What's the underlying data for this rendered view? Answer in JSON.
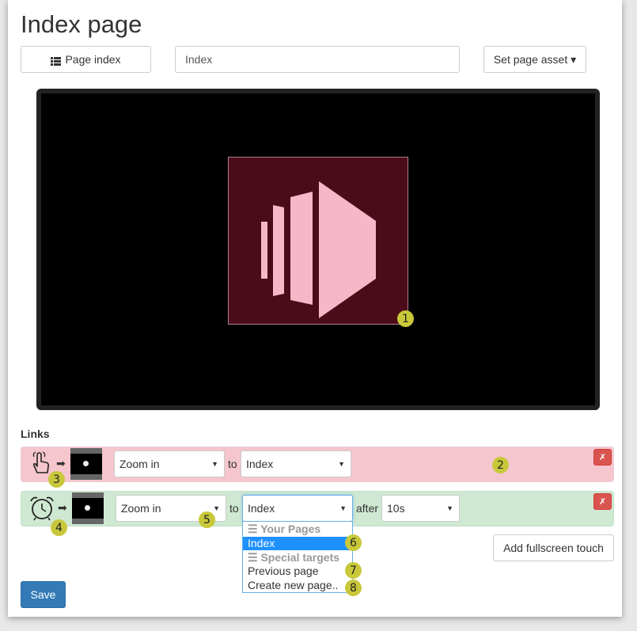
{
  "page": {
    "title": "Index page",
    "page_index_label": "Page index",
    "page_name_value": "Index",
    "set_asset_label": "Set page asset ▾"
  },
  "links": {
    "section_label": "Links",
    "touch_link": {
      "trigger_icon": "hand-pointer-icon",
      "transition": "Zoom in",
      "to_label": "to",
      "target": "Index",
      "delete_label": "✗"
    },
    "timer_link": {
      "trigger_icon": "alarm-clock-icon",
      "transition": "Zoom in",
      "to_label": "to",
      "target": "Index",
      "after_label": "after",
      "delay": "10s",
      "delete_label": "✗"
    },
    "target_dropdown": {
      "group_your_pages": "☰ Your Pages",
      "item_index": "Index",
      "group_special": "☰ Special targets",
      "item_previous": "Previous page",
      "item_create": "Create new page.."
    },
    "add_fullscreen_label": "Add fullscreen touch"
  },
  "save_label": "Save",
  "annotations": [
    "1",
    "2",
    "3",
    "4",
    "5",
    "6",
    "7",
    "8"
  ],
  "colors": {
    "touch_row": "#f5c6cd",
    "timer_row": "#cfe8d2",
    "asset_bg": "#4a0c18",
    "asset_fg": "#f6b8c8",
    "badge": "#c8c83a",
    "primary": "#337ab7",
    "danger": "#d9534f"
  }
}
